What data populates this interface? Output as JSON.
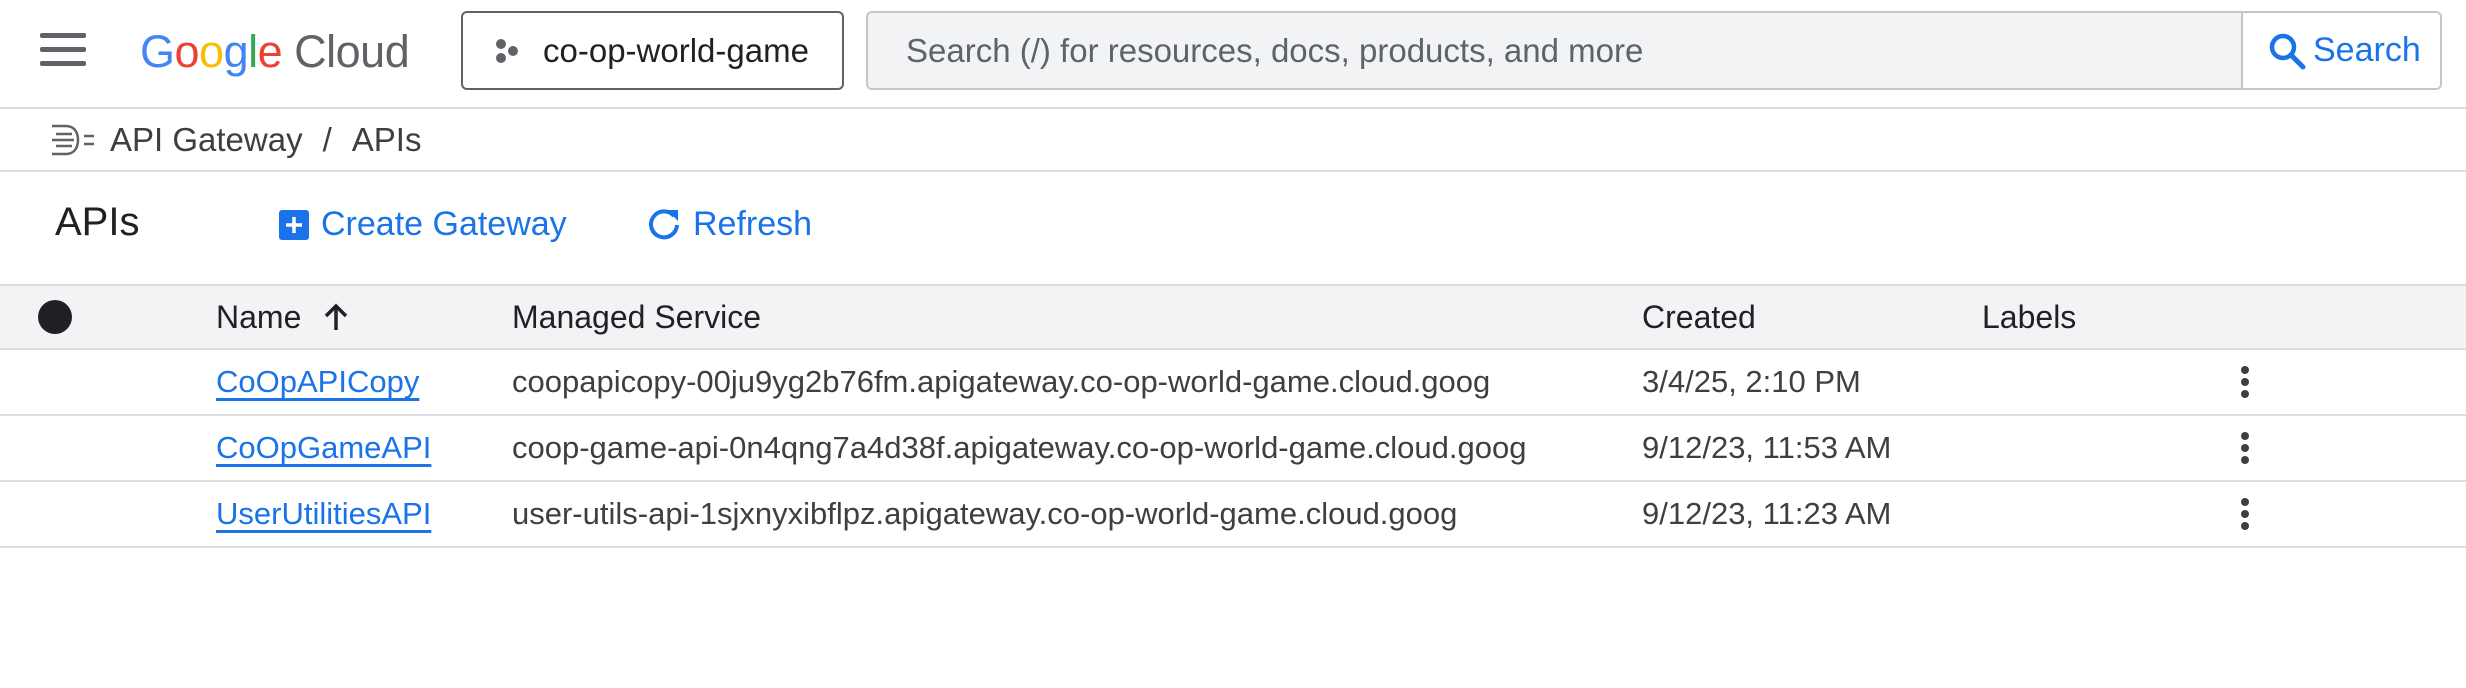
{
  "topbar": {
    "logo_letters": [
      "G",
      "o",
      "o",
      "g",
      "l",
      "e"
    ],
    "logo_product": "Cloud",
    "project": "co-op-world-game",
    "search_placeholder": "Search (/) for resources, docs, products, and more",
    "search_button": "Search"
  },
  "breadcrumb": {
    "product": "API Gateway",
    "separator": "/",
    "page": "APIs"
  },
  "page": {
    "title": "APIs",
    "actions": {
      "create": "Create Gateway",
      "refresh": "Refresh"
    }
  },
  "table": {
    "headers": {
      "name": "Name",
      "managed_service": "Managed Service",
      "created": "Created",
      "labels": "Labels"
    },
    "sort": "ascending",
    "rows": [
      {
        "name": "CoOpAPICopy",
        "managed_service": "coopapicopy-00ju9yg2b76fm.apigateway.co-op-world-game.cloud.goog",
        "created": "3/4/25, 2:10 PM",
        "labels": ""
      },
      {
        "name": "CoOpGameAPI",
        "managed_service": "coop-game-api-0n4qng7a4d38f.apigateway.co-op-world-game.cloud.goog",
        "created": "9/12/23, 11:53 AM",
        "labels": ""
      },
      {
        "name": "UserUtilitiesAPI",
        "managed_service": "user-utils-api-1sjxnyxibflpz.apigateway.co-op-world-game.cloud.goog",
        "created": "9/12/23, 11:23 AM",
        "labels": ""
      }
    ]
  },
  "colors": {
    "link": "#1a73e8",
    "text": "#3c4043",
    "header_bg": "#f1f3f4",
    "divider": "#dadce0"
  },
  "icons": {
    "menu": "hamburger-menu-icon",
    "project": "project-dots-icon",
    "search": "search-icon",
    "gateway": "api-gateway-icon",
    "create": "add-box-icon",
    "refresh": "refresh-icon",
    "sort": "arrow-up-icon",
    "row_menu": "more-vert-icon"
  }
}
